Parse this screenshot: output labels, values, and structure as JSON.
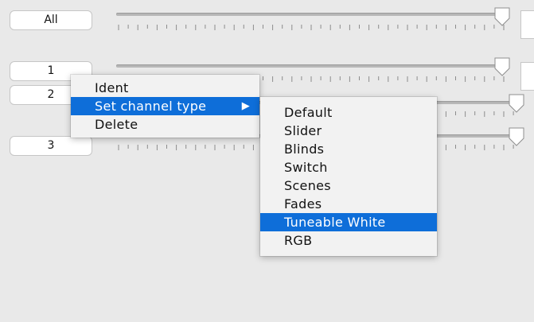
{
  "channels": {
    "all_label": "All",
    "rows": [
      {
        "label": "1"
      },
      {
        "label": "2"
      },
      {
        "label": "3"
      }
    ]
  },
  "context_menu": {
    "items": [
      "Ident",
      "Set channel type",
      "Delete"
    ],
    "highlighted": "Set channel type",
    "submenu_arrow": "▶"
  },
  "submenu": {
    "items": [
      "Default",
      "Slider",
      "Blinds",
      "Switch",
      "Scenes",
      "Fades",
      "Tuneable White",
      "RGB"
    ],
    "highlighted": "Tuneable White"
  },
  "colors": {
    "highlight": "#0e6ed9",
    "background": "#e9e9e9"
  },
  "sliders": {
    "all": 1.0,
    "ch1": 1.0,
    "ch2": 1.0,
    "ch3": 1.0
  }
}
